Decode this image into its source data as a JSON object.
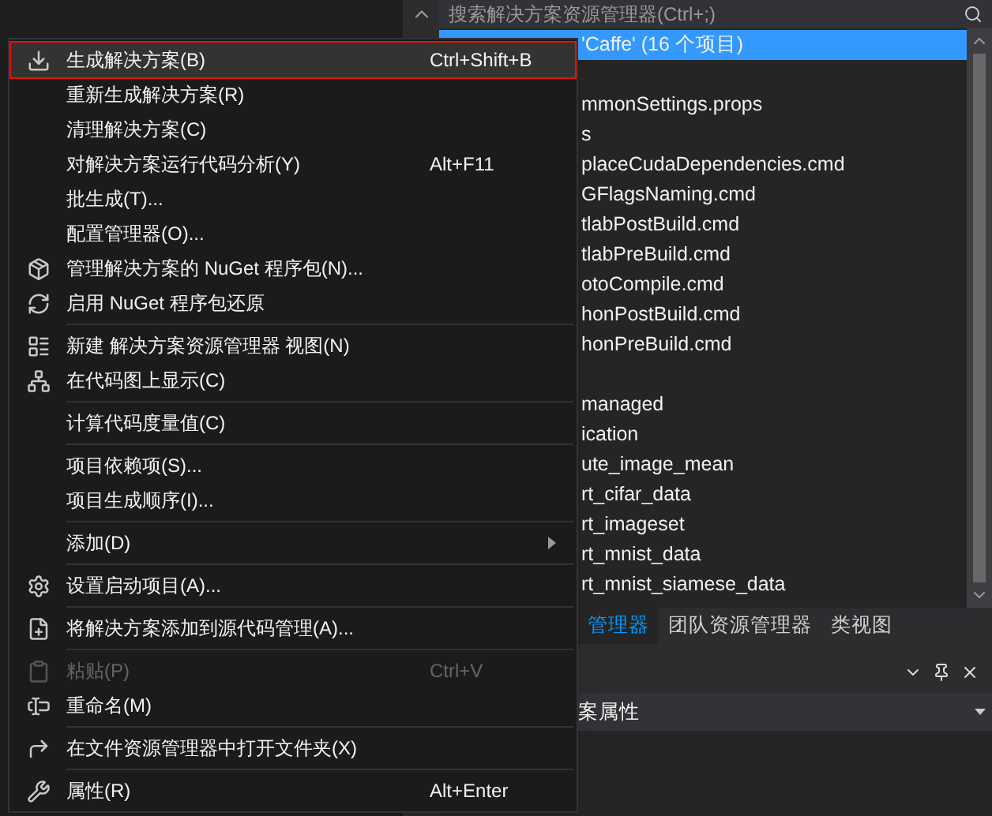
{
  "explorer": {
    "search": {
      "placeholder": "搜索解决方案资源管理器(Ctrl+;)"
    },
    "tree": [
      {
        "label": "'Caffe' (16 个项目)",
        "selected": true
      },
      {
        "selected": false
      },
      {
        "label": "mmonSettings.props",
        "selected": false
      },
      {
        "label": "s",
        "selected": false
      },
      {
        "label": "placeCudaDependencies.cmd",
        "selected": false
      },
      {
        "label": "GFlagsNaming.cmd",
        "selected": false
      },
      {
        "label": "tlabPostBuild.cmd",
        "selected": false
      },
      {
        "label": "tlabPreBuild.cmd",
        "selected": false
      },
      {
        "label": "otoCompile.cmd",
        "selected": false
      },
      {
        "label": "honPostBuild.cmd",
        "selected": false
      },
      {
        "label": "honPreBuild.cmd",
        "selected": false
      },
      {
        "selected": false
      },
      {
        "label": "managed",
        "selected": false
      },
      {
        "label": "ication",
        "selected": false
      },
      {
        "label": "ute_image_mean",
        "selected": false
      },
      {
        "label": "rt_cifar_data",
        "selected": false
      },
      {
        "label": "rt_imageset",
        "selected": false
      },
      {
        "label": "rt_mnist_data",
        "selected": false
      },
      {
        "label": "rt_mnist_siamese_data",
        "selected": false
      }
    ],
    "tabs": [
      {
        "label": "管理器",
        "selected": true
      },
      {
        "label": "团队资源管理器",
        "selected": false
      },
      {
        "label": "类视图",
        "selected": false
      }
    ]
  },
  "properties": {
    "object": "案属性"
  },
  "menu": [
    {
      "kind": "item",
      "label": "生成解决方案(B)",
      "shortcut": "Ctrl+Shift+B",
      "selected": true,
      "disabled": false
    },
    {
      "kind": "item",
      "label": "重新生成解决方案(R)",
      "selected": false,
      "disabled": false
    },
    {
      "kind": "item",
      "label": "清理解决方案(C)",
      "selected": false,
      "disabled": false
    },
    {
      "kind": "item",
      "label": "对解决方案运行代码分析(Y)",
      "shortcut": "Alt+F11",
      "selected": false,
      "disabled": false
    },
    {
      "kind": "item",
      "label": "批生成(T)...",
      "selected": false,
      "disabled": false
    },
    {
      "kind": "item",
      "label": "配置管理器(O)...",
      "selected": false,
      "disabled": false
    },
    {
      "kind": "item",
      "label": "管理解决方案的 NuGet 程序包(N)...",
      "selected": false,
      "disabled": false
    },
    {
      "kind": "item",
      "label": "启用 NuGet 程序包还原",
      "selected": false,
      "disabled": false
    },
    {
      "kind": "separator"
    },
    {
      "kind": "item",
      "label": "新建 解决方案资源管理器 视图(N)",
      "selected": false,
      "disabled": false
    },
    {
      "kind": "item",
      "label": "在代码图上显示(C)",
      "selected": false,
      "disabled": false
    },
    {
      "kind": "separator"
    },
    {
      "kind": "item",
      "label": "计算代码度量值(C)",
      "selected": false,
      "disabled": false
    },
    {
      "kind": "separator"
    },
    {
      "kind": "item",
      "label": "项目依赖项(S)...",
      "selected": false,
      "disabled": false
    },
    {
      "kind": "item",
      "label": "项目生成顺序(I)...",
      "selected": false,
      "disabled": false
    },
    {
      "kind": "separator"
    },
    {
      "kind": "item",
      "label": "添加(D)",
      "submenu": true,
      "selected": false,
      "disabled": false
    },
    {
      "kind": "separator"
    },
    {
      "kind": "item",
      "label": "设置启动项目(A)...",
      "selected": false,
      "disabled": false
    },
    {
      "kind": "separator"
    },
    {
      "kind": "item",
      "label": "将解决方案添加到源代码管理(A)...",
      "selected": false,
      "disabled": false
    },
    {
      "kind": "separator"
    },
    {
      "kind": "item",
      "label": "粘贴(P)",
      "shortcut": "Ctrl+V",
      "selected": false,
      "disabled": true
    },
    {
      "kind": "item",
      "label": "重命名(M)",
      "selected": false,
      "disabled": false
    },
    {
      "kind": "separator"
    },
    {
      "kind": "item",
      "label": "在文件资源管理器中打开文件夹(X)",
      "selected": false,
      "disabled": false
    },
    {
      "kind": "separator"
    },
    {
      "kind": "item",
      "label": "属性(R)",
      "shortcut": "Alt+Enter",
      "selected": false,
      "disabled": false
    }
  ]
}
